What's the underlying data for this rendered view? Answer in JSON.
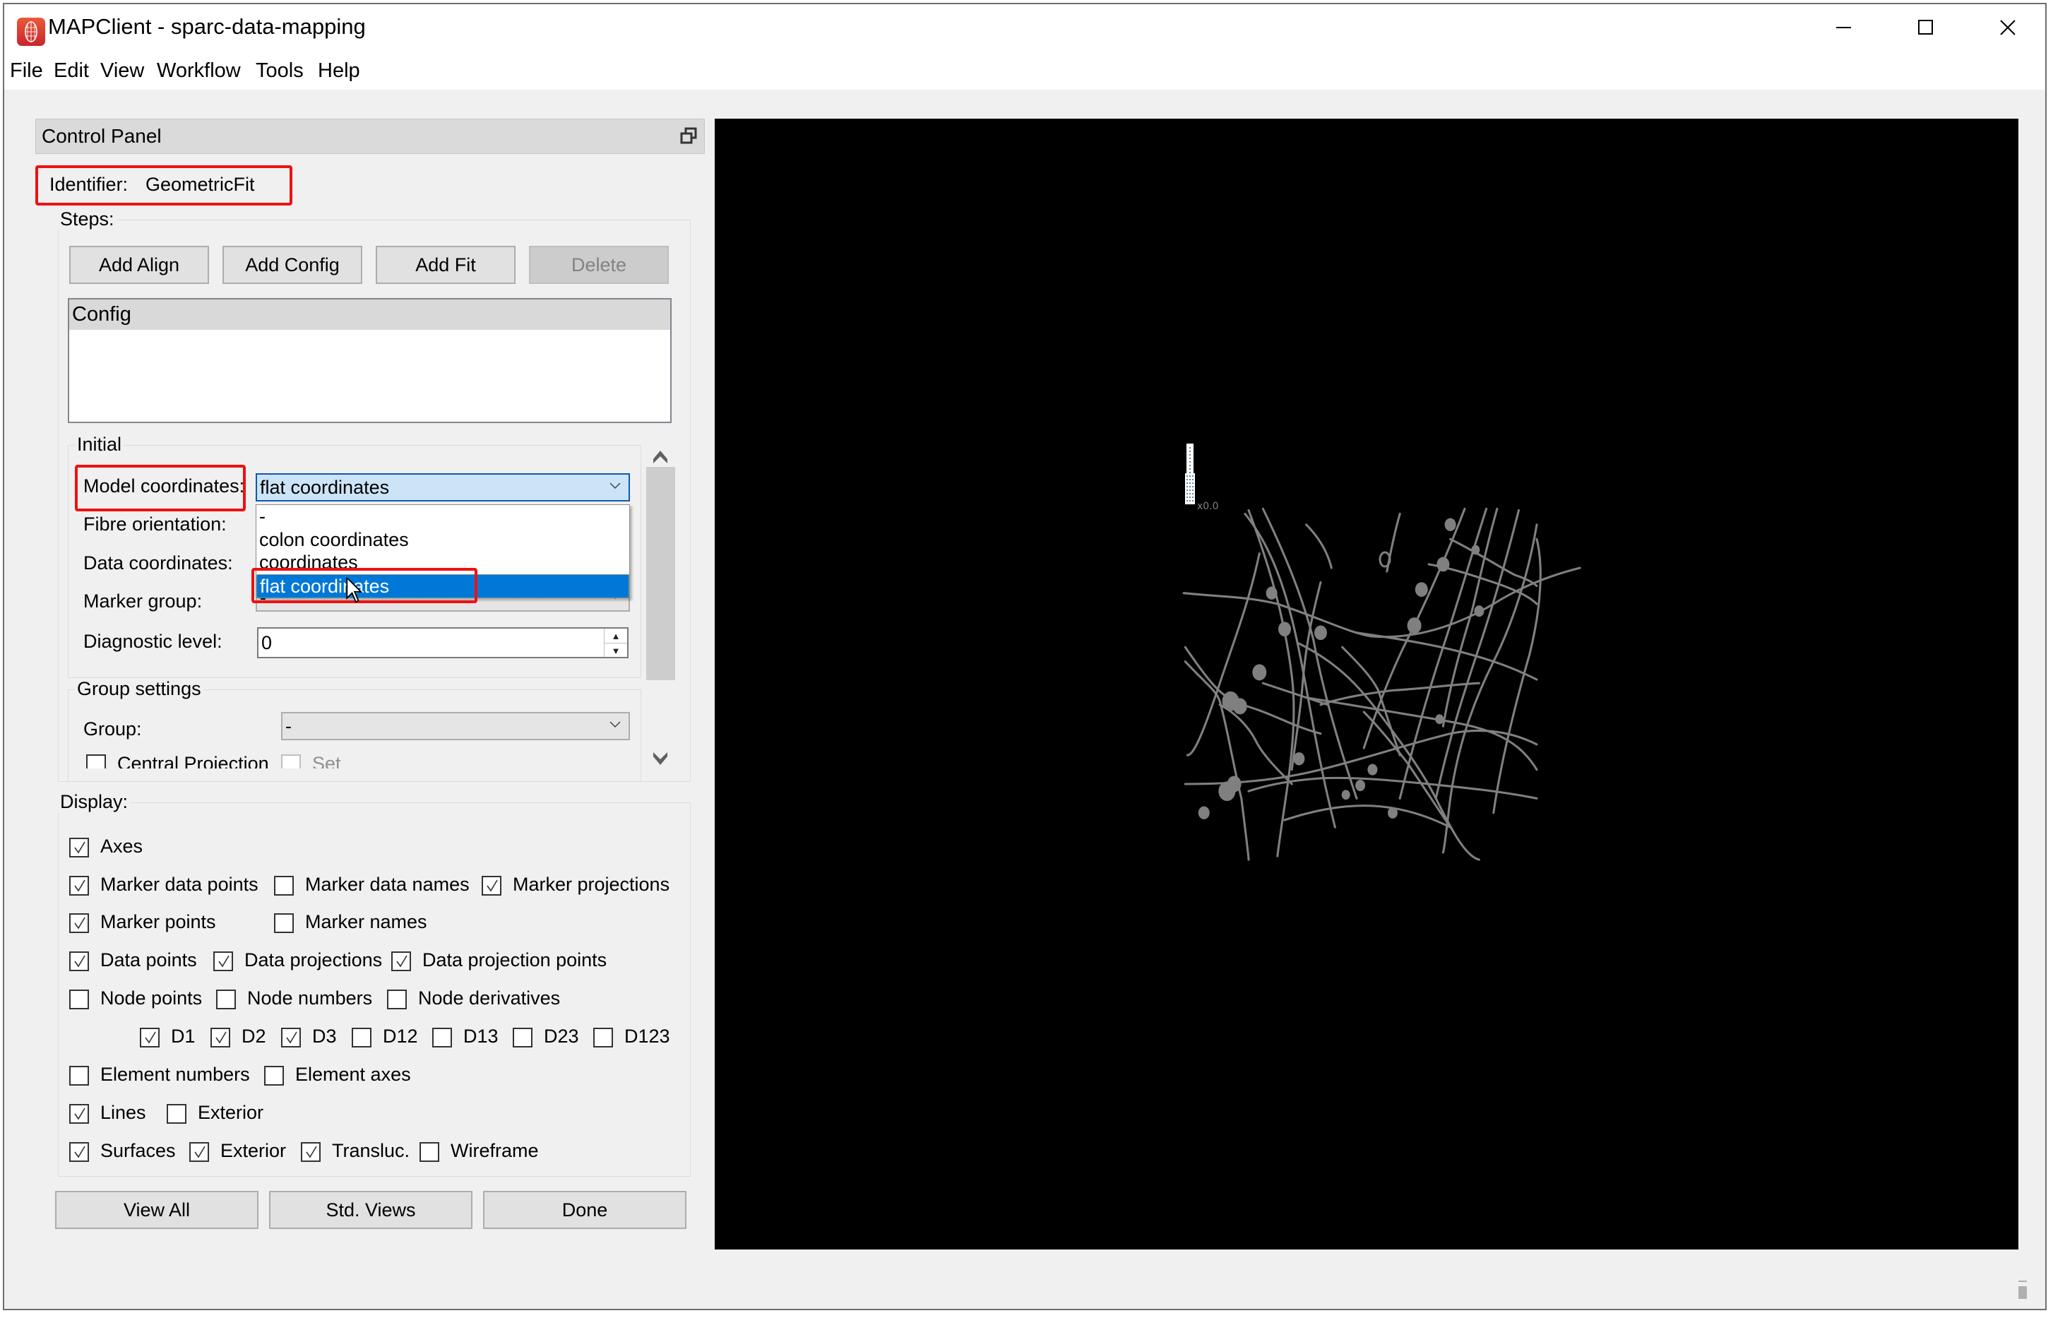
{
  "window": {
    "title": "MAPClient - sparc-data-mapping",
    "icon": "mapclient-logo-icon",
    "controls": [
      "minimize-icon",
      "maximize-icon",
      "close-icon"
    ]
  },
  "menubar": [
    "File",
    "Edit",
    "View",
    "Workflow",
    "Tools",
    "Help"
  ],
  "control_panel": {
    "title": "Control Panel",
    "identifier_label": "Identifier:",
    "identifier_value": "GeometricFit",
    "steps": {
      "title": "Steps:",
      "buttons": {
        "add_align": "Add Align",
        "add_config": "Add Config",
        "add_fit": "Add Fit",
        "delete": "Delete"
      },
      "list_items": [
        "Config"
      ]
    },
    "initial": {
      "title": "Initial",
      "model_coordinates_label": "Model coordinates:",
      "model_coordinates_value": "flat coordinates",
      "model_coordinates_options": [
        "-",
        "colon coordinates",
        "coordinates",
        "flat coordinates"
      ],
      "model_coordinates_highlighted": "flat coordinates",
      "fibre_orientation_label": "Fibre orientation:",
      "data_coordinates_label": "Data coordinates:",
      "marker_group_label": "Marker group:",
      "marker_group_value": "-",
      "diagnostic_level_label": "Diagnostic level:",
      "diagnostic_level_value": "0"
    },
    "group_settings": {
      "title": "Group settings",
      "group_label": "Group:",
      "group_value": "-",
      "central_projection_label": "Central Projection",
      "central_projection_checked": false,
      "set_label": "Set",
      "set_checked": false
    },
    "display": {
      "title": "Display:",
      "rows": [
        [
          {
            "label": "Axes",
            "checked": true
          }
        ],
        [
          {
            "label": "Marker data points",
            "checked": true
          },
          {
            "label": "Marker data names",
            "checked": false
          },
          {
            "label": "Marker projections",
            "checked": true
          }
        ],
        [
          {
            "label": "Marker points",
            "checked": true
          },
          {
            "label": "Marker names",
            "checked": false
          }
        ],
        [
          {
            "label": "Data points",
            "checked": true
          },
          {
            "label": "Data projections",
            "checked": true
          },
          {
            "label": "Data projection points",
            "checked": true
          }
        ],
        [
          {
            "label": "Node points",
            "checked": false
          },
          {
            "label": "Node numbers",
            "checked": false
          },
          {
            "label": "Node derivatives",
            "checked": false
          }
        ],
        [
          {
            "label": "D1",
            "checked": true
          },
          {
            "label": "D2",
            "checked": true
          },
          {
            "label": "D3",
            "checked": true
          },
          {
            "label": "D12",
            "checked": false
          },
          {
            "label": "D13",
            "checked": false
          },
          {
            "label": "D23",
            "checked": false
          },
          {
            "label": "D123",
            "checked": false
          }
        ],
        [
          {
            "label": "Element numbers",
            "checked": false
          },
          {
            "label": "Element axes",
            "checked": false
          }
        ],
        [
          {
            "label": "Lines",
            "checked": true
          },
          {
            "label": "Exterior",
            "checked": false
          }
        ],
        [
          {
            "label": "Surfaces",
            "checked": true
          },
          {
            "label": "Exterior",
            "checked": true
          },
          {
            "label": "Transluc.",
            "checked": true
          },
          {
            "label": "Wireframe",
            "checked": false
          }
        ]
      ]
    },
    "bottom_buttons": {
      "view_all": "View All",
      "std_views": "Std. Views",
      "done": "Done"
    }
  },
  "viewport": {
    "background": "#000000",
    "axis_label": "x0.0",
    "mesh_color": "#808080"
  },
  "colors": {
    "highlight_red": "#ee1111",
    "selection_blue": "#0078d7",
    "combo_active": "#cce4f7"
  }
}
